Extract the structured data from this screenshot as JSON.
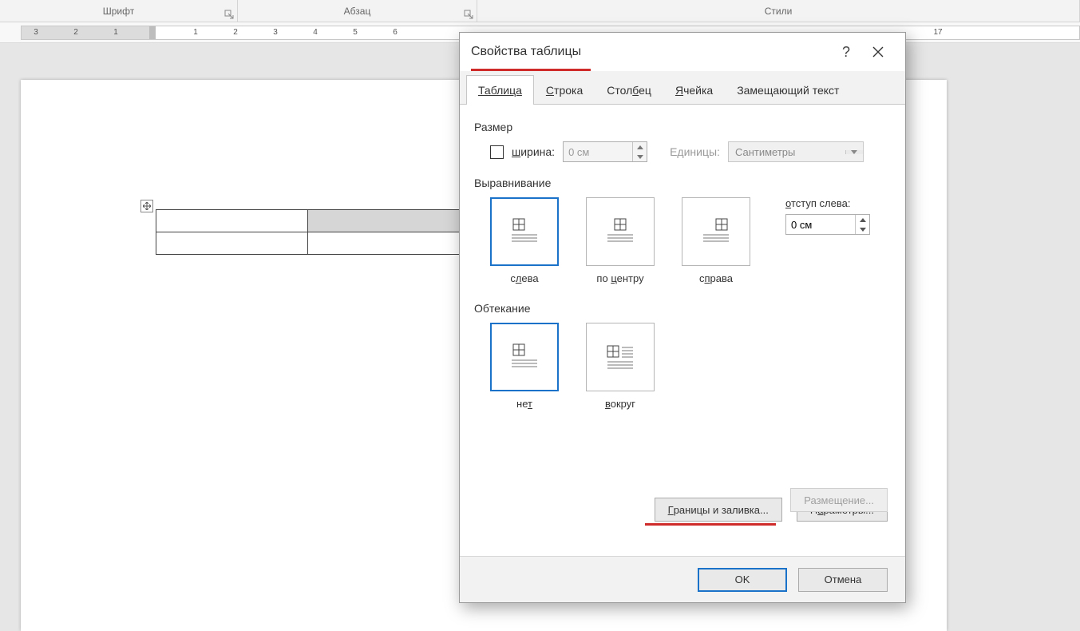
{
  "ribbon": {
    "font": "Шрифт",
    "paragraph": "Абзац",
    "styles": "Стили"
  },
  "ruler": {
    "labels": [
      "3",
      "2",
      "1",
      "1",
      "2",
      "3",
      "4",
      "5",
      "6",
      "17"
    ]
  },
  "dialog": {
    "title": "Свойства таблицы",
    "help": "?",
    "tabs": {
      "table": "Таблица",
      "row": "Строка",
      "column": "Столбец",
      "cell": "Ячейка",
      "alt": "Замещающий текст"
    },
    "size": {
      "label": "Размер",
      "width_label": "ширина:",
      "width_value": "0 см",
      "units_label": "Единицы:",
      "units_value": "Сантиметры"
    },
    "align": {
      "label": "Выравнивание",
      "left": "слева",
      "center": "по центру",
      "right": "справа",
      "indent_label": "отступ слева:",
      "indent_value": "0 см"
    },
    "wrap": {
      "label": "Обтекание",
      "none": "нет",
      "around": "вокруг",
      "placement": "Размещение..."
    },
    "buttons": {
      "borders": "Границы и заливка...",
      "options": "Параметры...",
      "ok": "OK",
      "cancel": "Отмена"
    }
  }
}
